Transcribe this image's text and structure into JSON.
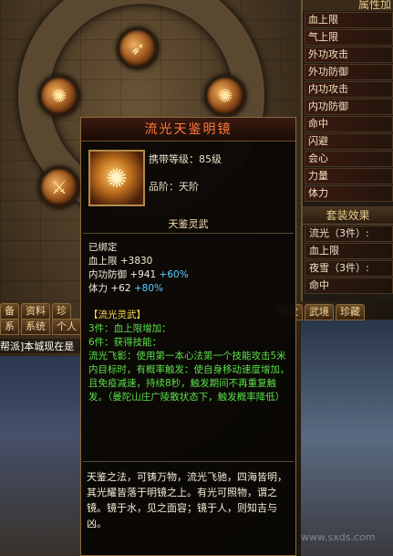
{
  "attributes_panel": {
    "header": "属性加",
    "rows": [
      "血上限",
      "气上限",
      "外功攻击",
      "外功防御",
      "内功攻击",
      "内功防御",
      "命中",
      "闪避",
      "会心",
      "力量",
      "体力"
    ]
  },
  "set_panel": {
    "title": "套装效果",
    "rows": [
      "流光（3件）:",
      "血上限",
      "夜雪（3件）:",
      "命中"
    ]
  },
  "tabs_right": [
    "睹纹",
    "武境",
    "珍藏"
  ],
  "tabs_left_row1": [
    "备",
    "资料",
    "珍"
  ],
  "tabs_left_row2": [
    "系",
    "系统",
    "个人"
  ],
  "chat_line": "帮派]本城现在是",
  "tooltip": {
    "title": "流光天鉴明镜",
    "level": "携带等级：85级",
    "grade": "品阶：天阶",
    "type": "天鉴灵武",
    "bound": "已绑定",
    "stats": [
      {
        "label": "血上限",
        "value": "+3830",
        "bonus": ""
      },
      {
        "label": "内功防御",
        "value": "+941",
        "bonus": "+60%"
      },
      {
        "label": "体力",
        "value": "+62",
        "bonus": "+80%"
      }
    ],
    "set_name": "【流光灵武】",
    "set_lines": [
      {
        "text": "3件：血上限增加：",
        "style": "green"
      },
      {
        "text": "6件：获得技能：",
        "style": "green"
      },
      {
        "text": "流光飞影：使用第一本心法第一个技能攻击5米内目标时，有概率触发：使自身移动速度增加，且免疫减速，持续8秒，触发期间不再重复触发。（曼陀山庄广陵散状态下，触发概率降低）",
        "style": "green"
      }
    ],
    "lore": "天鉴之法，可铸万物，流光飞驰，四海皆明，其光耀皆落于明镜之上。有光可照物，谓之镜。镜于水，见之面容；镜于人，则知吉与凶。"
  },
  "watermark": "www.sxds.com"
}
